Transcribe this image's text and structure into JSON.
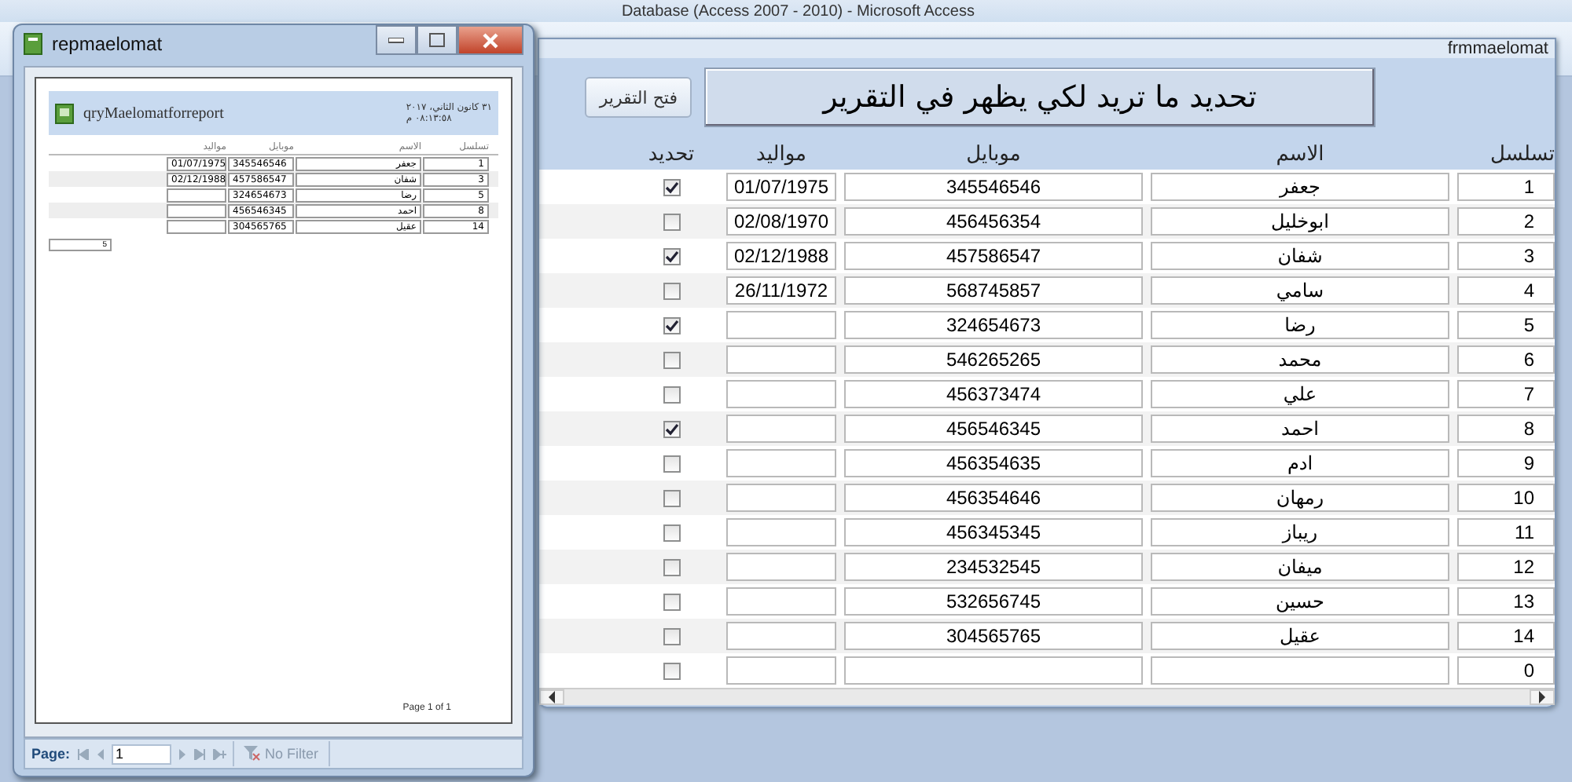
{
  "app_window": {
    "title": "Database (Access 2007 - 2010)  -  Microsoft Access"
  },
  "form": {
    "title": "frmmaelomat",
    "open_button": "فتح التقرير",
    "heading": "تحديد ما تريد لكي يظهر في التقرير",
    "columns": [
      "تسلسل",
      "الاسم",
      "موبايل",
      "مواليد",
      "تحديد"
    ],
    "rows": [
      {
        "seq": "1",
        "name": "جعفر",
        "mobile": "345546546",
        "birth": "01/07/1975",
        "checked": true
      },
      {
        "seq": "2",
        "name": "ابوخليل",
        "mobile": "456456354",
        "birth": "02/08/1970",
        "checked": false
      },
      {
        "seq": "3",
        "name": "شفان",
        "mobile": "457586547",
        "birth": "02/12/1988",
        "checked": true
      },
      {
        "seq": "4",
        "name": "سامي",
        "mobile": "568745857",
        "birth": "26/11/1972",
        "checked": false
      },
      {
        "seq": "5",
        "name": "رضا",
        "mobile": "324654673",
        "checked": true
      },
      {
        "seq": "6",
        "name": "محمد",
        "mobile": "546265265",
        "checked": false
      },
      {
        "seq": "7",
        "name": "علي",
        "mobile": "456373474",
        "checked": false
      },
      {
        "seq": "8",
        "name": "احمد",
        "mobile": "456546345",
        "checked": true
      },
      {
        "seq": "9",
        "name": "ادم",
        "mobile": "456354635",
        "checked": false
      },
      {
        "seq": "10",
        "name": "رمهان",
        "mobile": "456354646",
        "checked": false
      },
      {
        "seq": "11",
        "name": "ريباز",
        "mobile": "456345345",
        "checked": false
      },
      {
        "seq": "12",
        "name": "ميفان",
        "mobile": "234532545",
        "checked": false
      },
      {
        "seq": "13",
        "name": "حسين",
        "mobile": "532656745",
        "checked": false
      },
      {
        "seq": "14",
        "name": "عقيل",
        "mobile": "304565765",
        "checked": false
      },
      {
        "seq": "0",
        "checked": false
      }
    ]
  },
  "report_window": {
    "title": "repmaelomat",
    "report_title": "qryMaelomatforreport",
    "date": "٣١ كانون الثاني، ٢٠١٧",
    "time": "٠٨:١٣:٥٨ م",
    "columns": [
      "تسلسل",
      "الاسم",
      "موبايل",
      "مواليد"
    ],
    "rows": [
      {
        "seq": "1",
        "name": "جعفر",
        "mobile": "345546546",
        "birth": "01/07/1975"
      },
      {
        "seq": "3",
        "name": "شفان",
        "mobile": "457586547",
        "birth": "02/12/1988"
      },
      {
        "seq": "5",
        "name": "رضا",
        "mobile": "324654673"
      },
      {
        "seq": "8",
        "name": "احمد",
        "mobile": "456546345"
      },
      {
        "seq": "14",
        "name": "عقيل",
        "mobile": "304565765"
      }
    ],
    "count": "5",
    "page_footer": "Page 1 of 1",
    "nav": {
      "label": "Page:",
      "page": "1",
      "filter": "No Filter"
    }
  }
}
